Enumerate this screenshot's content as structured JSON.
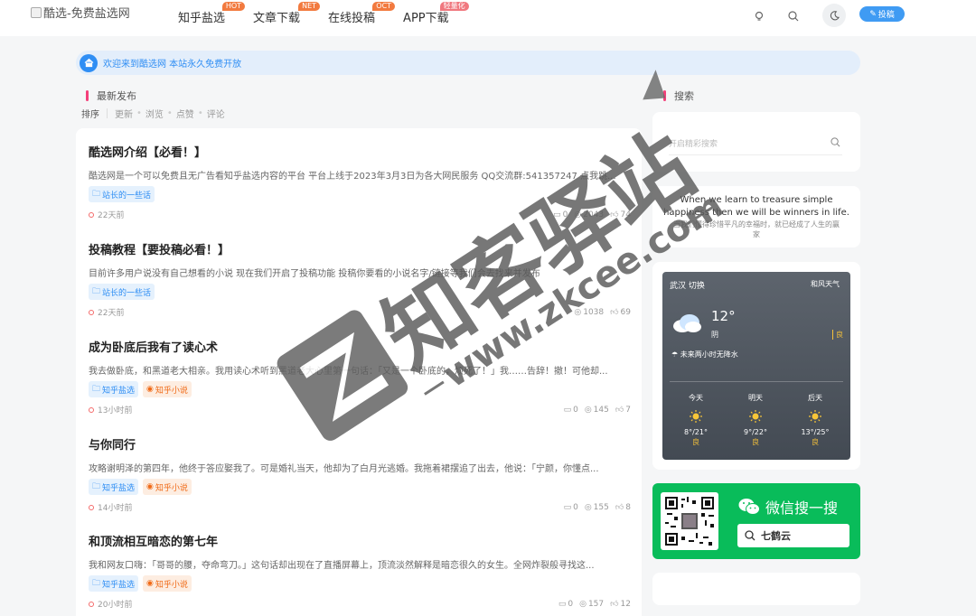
{
  "header": {
    "logo_alt": "酷选-免费盐选网",
    "nav": [
      {
        "label": "知乎盐选",
        "badge": "HOT"
      },
      {
        "label": "文章下载",
        "badge": "NET"
      },
      {
        "label": "在线投稿",
        "badge": "OCT"
      },
      {
        "label": "APP下载",
        "badge": "轻量化"
      }
    ],
    "submit_label": "投稿"
  },
  "notice": {
    "text": "欢迎来到酷选网 本站永久免费开放"
  },
  "latest": {
    "title": "最新发布",
    "sort_label": "排序",
    "sort_options": [
      "更新",
      "浏览",
      "点赞",
      "评论"
    ]
  },
  "posts": [
    {
      "title": "酷选网介绍【必看！】",
      "excerpt": "酷选网是一个可以免费且无广告看知乎盐选内容的平台 平台上线于2023年3月3日为各大网民服务 QQ交流群:541357247 点我跳...",
      "tags": [
        "站长的一些话"
      ],
      "time": "22天前",
      "comments": "0",
      "views": "2043",
      "likes": "74"
    },
    {
      "title": "投稿教程【要投稿必看！】",
      "excerpt": "目前许多用户说没有自己想看的小说 现在我们开启了投稿功能 投稿你要看的小说名字/链接等我们会去找来并发布",
      "tags": [
        "站长的一些话"
      ],
      "time": "22天前",
      "comments": "",
      "views": "1038",
      "likes": "69"
    },
    {
      "title": "成为卧底后我有了读心术",
      "excerpt": "我去做卧底，和黑道老大相亲。我用读心术听到黑道老大心里第一句话：「又是一个卧底的，烦死了！」我……告辞！撤！可他却...",
      "tags": [
        "知乎盐选",
        "知乎小说"
      ],
      "time": "13小时前",
      "comments": "0",
      "views": "145",
      "likes": "7"
    },
    {
      "title": "与你同行",
      "excerpt": "攻略谢明泽的第四年，他终于答应娶我了。可是婚礼当天，他却为了白月光逃婚。我拖着裙摆追了出去，他说：「宁颜，你懂点...",
      "tags": [
        "知乎盐选",
        "知乎小说"
      ],
      "time": "14小时前",
      "comments": "0",
      "views": "155",
      "likes": "8"
    },
    {
      "title": "和顶流相互暗恋的第七年",
      "excerpt": "我和网友口嗨：「哥哥的腰，夺命弯刀。」这句话却出现在了直播屏幕上，顶流淡然解释是暗恋很久的女生。全网炸裂般寻找这...",
      "tags": [
        "知乎盐选",
        "知乎小说"
      ],
      "time": "20小时前",
      "comments": "0",
      "views": "157",
      "likes": "12"
    }
  ],
  "sidebar": {
    "search_title": "搜索",
    "search_placeholder": "开启精彩搜索",
    "quote_en": "When we learn to treasure simple happiness then we will be winners in life.",
    "quote_zh": "当我们懂得珍惜平凡的幸福时，就已经成了人生的赢家",
    "weather": {
      "location": "武汉 切换",
      "brand": "和风天气",
      "temp": "12°",
      "condition": "阴",
      "aqi": "良",
      "forecast_note": "未来两小时无降水",
      "days": [
        {
          "day": "今天",
          "range": "8°/21°",
          "quality": "良"
        },
        {
          "day": "明天",
          "range": "9°/22°",
          "quality": "良"
        },
        {
          "day": "后天",
          "range": "13°/25°",
          "quality": "良"
        }
      ]
    },
    "wechat": {
      "title": "微信搜一搜",
      "keyword": "七鹤云"
    }
  },
  "watermark": {
    "main": "知客驿站",
    "url": "www.zkcee.com"
  },
  "colors": {
    "accent": "#2f8ef4",
    "title_bar": "#f43f7a",
    "wechat_green": "#09bc5a",
    "tag_orange": "#f06a17"
  }
}
